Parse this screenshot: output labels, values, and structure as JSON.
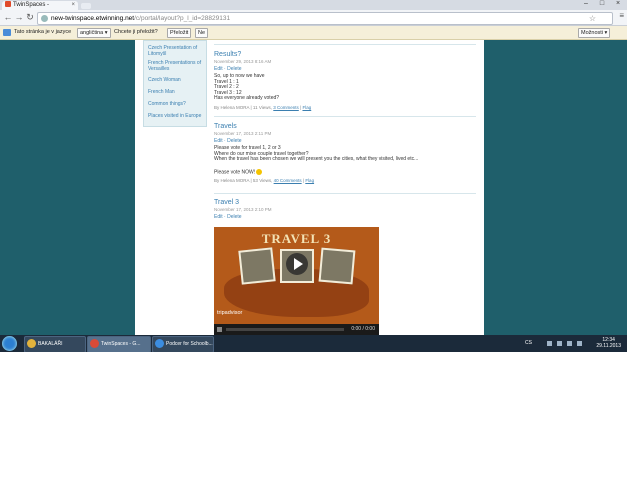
{
  "browser": {
    "tab_title": "TwinSpaces -",
    "tab_close": "×",
    "window_controls": [
      "–",
      "□",
      "×"
    ],
    "url_host": "new-twinspace.etwinning.net",
    "url_path": "/c/portal/layout?p_l_id=28829131"
  },
  "translate_bar": {
    "prompt": "Tato stránka je v jazyce",
    "language": "angličtina",
    "question": "Chcete ji přeložit?",
    "translate_button": "Přeložit",
    "no_button": "Ne",
    "options_button": "Možnosti"
  },
  "sidebar": {
    "items": [
      "Czech Presentation of Litomyšl",
      "French Presentations of Versailles",
      "Czech Woman",
      "French Man",
      "Common things?",
      "Places visited in Europe"
    ]
  },
  "posts": [
    {
      "title": "Results?",
      "date": "November 29, 2013 8:16 AM",
      "edit": "Edit",
      "delete": "Delete",
      "body": [
        "So, up to now we have",
        "Travel 1 : 1",
        "Travel 2 : 2",
        "Travel 3 : 12",
        "Has everyone already voted?"
      ],
      "meta_by": "By Helena MORA | 11 Views, ",
      "comments": "3 Comments",
      "flag": "Flag"
    },
    {
      "title": "Travels",
      "date": "November 17, 2013 2:11 PM",
      "edit": "Edit",
      "delete": "Delete",
      "body": [
        "Please vote for travel 1, 2 or 3",
        "Where do our mixe couple travel together?",
        "When the travel has been chosen we will present you the cities, what they visited, lived etc..."
      ],
      "vote_line": "Please vote NOW!",
      "meta_by": "By Helena MORA | 53 Views, ",
      "comments": "40 Comments",
      "flag": "Flag"
    },
    {
      "title": "Travel 3",
      "date": "November 17, 2013 2:10 PM",
      "edit": "Edit",
      "delete": "Delete"
    }
  ],
  "video": {
    "title": "TRAVEL 3",
    "brand": "tripadvisor",
    "time": "0:00 / 0:00"
  },
  "taskbar": {
    "tasks": [
      "BAKALÁŘI",
      "TwinSpaces - G...",
      "Podcer for Schoolb..."
    ],
    "language": "CS",
    "time": "12:34",
    "date": "29.11.2013"
  },
  "colors": {
    "page_bg": "#1f5f6b",
    "link": "#3b7fb0",
    "taskbar": "#1b2a3a"
  }
}
